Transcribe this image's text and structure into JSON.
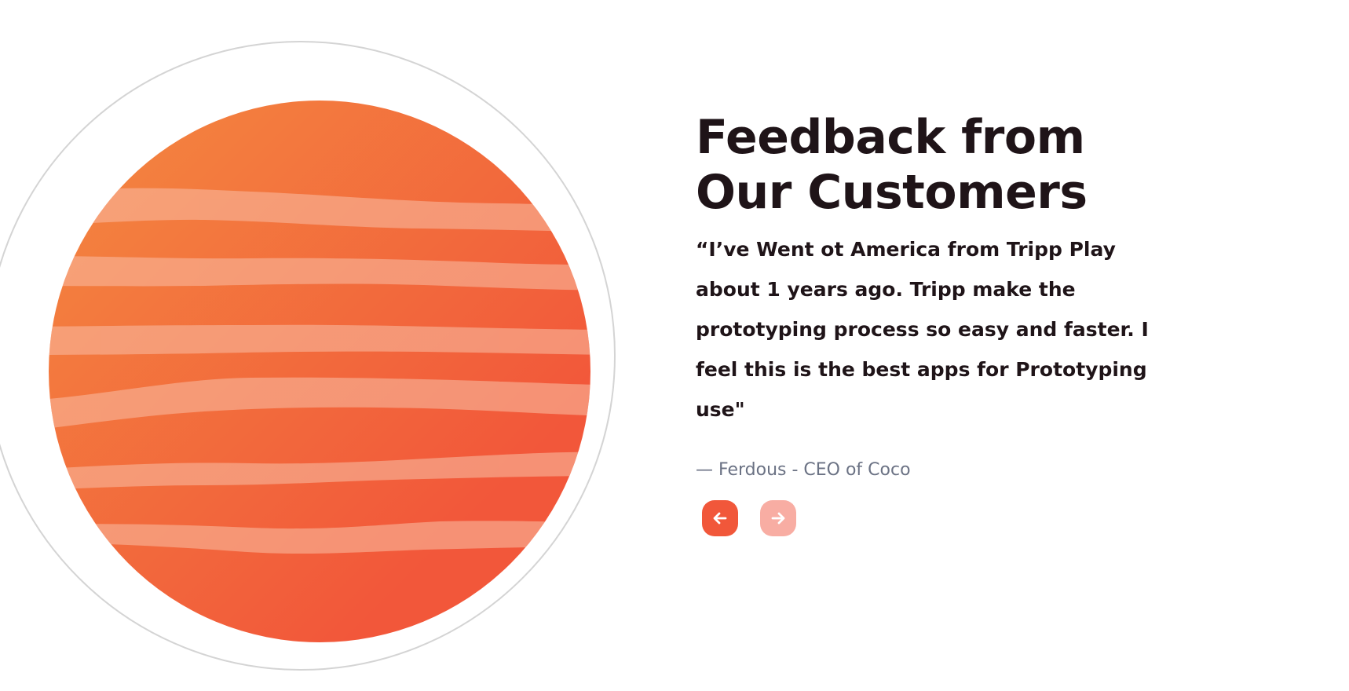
{
  "testimonial": {
    "heading_line1": "Feedback from",
    "heading_line2": "Our Customers",
    "quote": "“I’ve Went ot America from Tripp Play about 1 years ago. Tripp make the prototyping process so easy and faster. I feel this is the best apps for Prototyping use\"",
    "author": "— Ferdous - CEO of Coco"
  },
  "navigation": {
    "prev_icon": "arrow-left-icon",
    "next_icon": "arrow-right-icon"
  },
  "illustration": {
    "icon": "striped-planet-illustration",
    "colors": {
      "planet_start": "#f3813f",
      "planet_end": "#f2573a",
      "stripe": "#f8b59a",
      "orbit_ring": "#d4d4d4"
    }
  },
  "colors": {
    "heading": "#1f1418",
    "quote": "#1f1418",
    "author": "#6b7284",
    "accent": "#f1573a",
    "accent_light": "#f8ada3",
    "background": "#ffffff"
  }
}
